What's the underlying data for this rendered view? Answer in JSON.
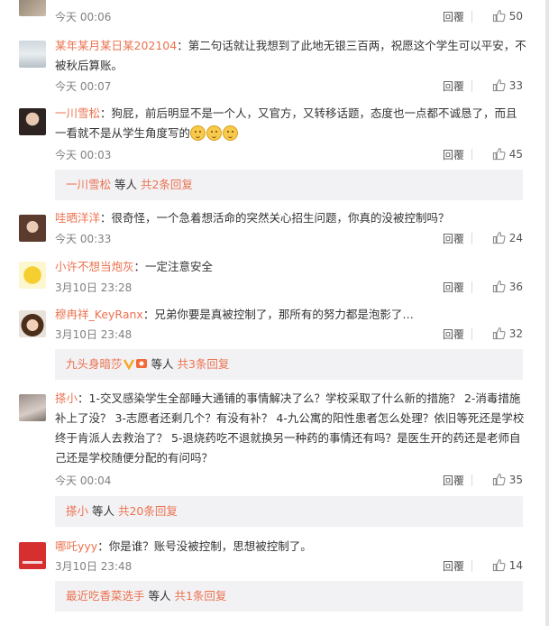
{
  "comments": [
    {
      "user": "",
      "sep": "",
      "text": "",
      "time": "今天 00:06",
      "reply": "回覆",
      "likes": "50"
    },
    {
      "user": "某年某月某日某202104",
      "sep": "：",
      "text": "第二句话就让我想到了此地无银三百两，祝愿这个学生可以平安，不被秋后算账。",
      "time": "今天 00:07",
      "reply": "回覆",
      "likes": "33"
    },
    {
      "user": "一川雪松",
      "sep": "：",
      "text": "狗屁，前后明显不是一个人，又官方，又转移话题，态度也一点都不诚恳了，而且一看就不是从学生角度写的",
      "time": "今天 00:03",
      "reply": "回覆",
      "likes": "45",
      "subreply": {
        "user": "一川雪松",
        "text": " 等人 ",
        "count": "共2条回复"
      }
    },
    {
      "user": "哇晒洋洋",
      "sep": "：",
      "text": "很奇怪，一个急着想活命的突然关心招生问题，你真的没被控制吗？",
      "time": "今天 00:33",
      "reply": "回覆",
      "likes": "24"
    },
    {
      "user": "小许不想当炮灰",
      "sep": "：",
      "text": "一定注意安全",
      "time": "3月10日 23:28",
      "reply": "回覆",
      "likes": "36"
    },
    {
      "user": "穆冉祥_KeyRanx",
      "sep": "：",
      "text": "兄弟你要是真被控制了，那所有的努力都是泡影了…",
      "time": "3月10日 23:48",
      "reply": "回覆",
      "likes": "32",
      "subreply": {
        "user": "九头身暗莎",
        "text": " 等人 ",
        "count": "共3条回复"
      }
    },
    {
      "user": "搽小",
      "sep": "：",
      "text": "1-交叉感染学生全部睡大通铺的事情解决了么？学校采取了什么新的措施？ 2-消毒措施补上了没？ 3-志愿者还剩几个？有没有补？ 4-九公寓的阳性患者怎么处理？依旧等死还是学校终于肯派人去救治了？ 5-退烧药吃不退就换另一种药的事情还有吗？是医生开的药还是老师自己还是学校随便分配的有问吗？",
      "time": "今天 00:04",
      "reply": "回覆",
      "likes": "35",
      "subreply": {
        "user": "搽小",
        "text": " 等人 ",
        "count": "共20条回复"
      }
    },
    {
      "user": "哪吒yyy",
      "sep": "：",
      "text": "你是谁？账号没被控制，思想被控制了。",
      "time": "3月10日 23:48",
      "reply": "回覆",
      "likes": "14",
      "subreply": {
        "user": "最近吃香菜选手",
        "text": " 等人 ",
        "count": "共1条回复"
      }
    }
  ]
}
